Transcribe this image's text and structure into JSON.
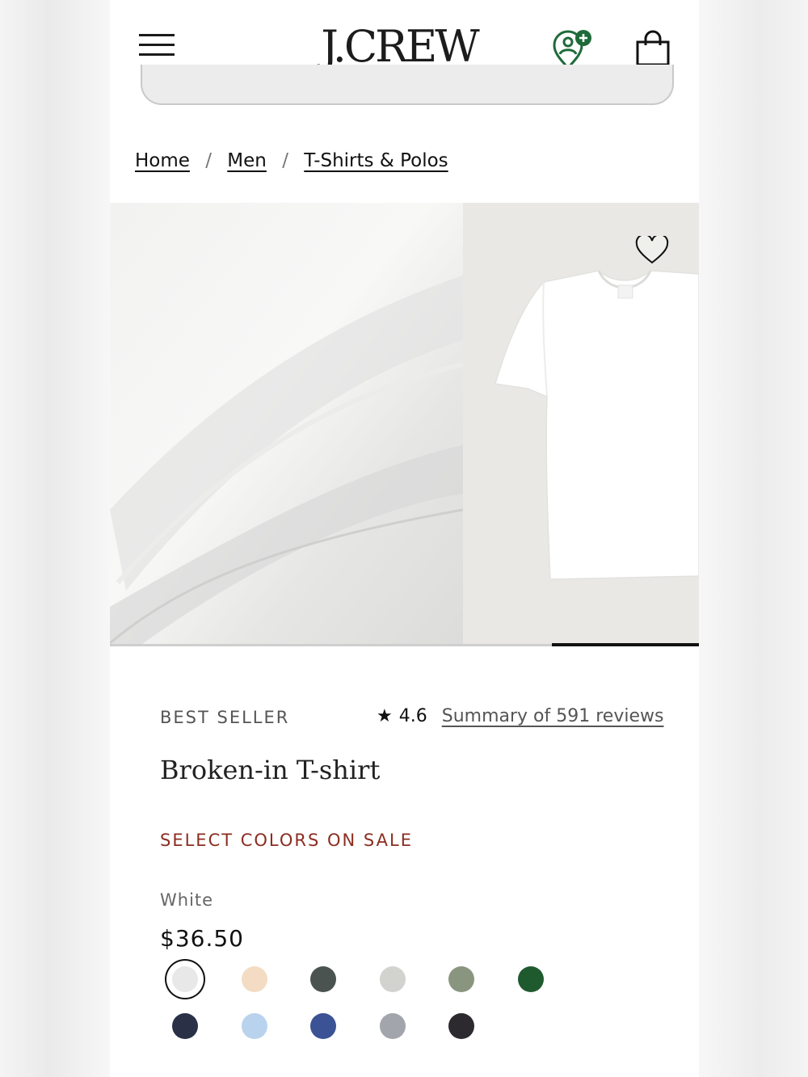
{
  "header": {
    "logo": "J.CREW",
    "menu_icon": "hamburger-menu-icon",
    "loyalty_icon": "loyalty-rewards-icon",
    "bag_icon": "shopping-bag-icon"
  },
  "breadcrumb": {
    "items": [
      "Home",
      "Men",
      "T-Shirts & Polos"
    ],
    "separator": "/"
  },
  "gallery": {
    "images": [
      "fabric-closeup",
      "white-tshirt-front"
    ],
    "wishlist_icon": "heart-icon"
  },
  "product": {
    "badge": "BEST SELLER",
    "rating_star": "★",
    "rating": "4.6",
    "reviews_link": "Summary of 591 reviews",
    "title": "Broken-in T-shirt",
    "sale_text": "SELECT COLORS ON SALE",
    "selected_color": "White",
    "price": "$36.50"
  },
  "swatches": [
    {
      "color": "#e8e8e8",
      "selected": true
    },
    {
      "color": "#f3dcc3",
      "selected": false
    },
    {
      "color": "#4a5350",
      "selected": false
    },
    {
      "color": "#d2d3cf",
      "selected": false
    },
    {
      "color": "#8a9580",
      "selected": false
    },
    {
      "color": "#1f5a2f",
      "selected": false
    },
    {
      "color": "#2a3147",
      "selected": false
    },
    {
      "color": "#b9d3ee",
      "selected": false
    },
    {
      "color": "#3b5294",
      "selected": false
    },
    {
      "color": "#a2a5ab",
      "selected": false
    },
    {
      "color": "#2c2a2f",
      "selected": false
    }
  ],
  "colors": {
    "sale": "#8b2d20",
    "loyalty_green": "#1e6b3a",
    "text": "#111111"
  }
}
